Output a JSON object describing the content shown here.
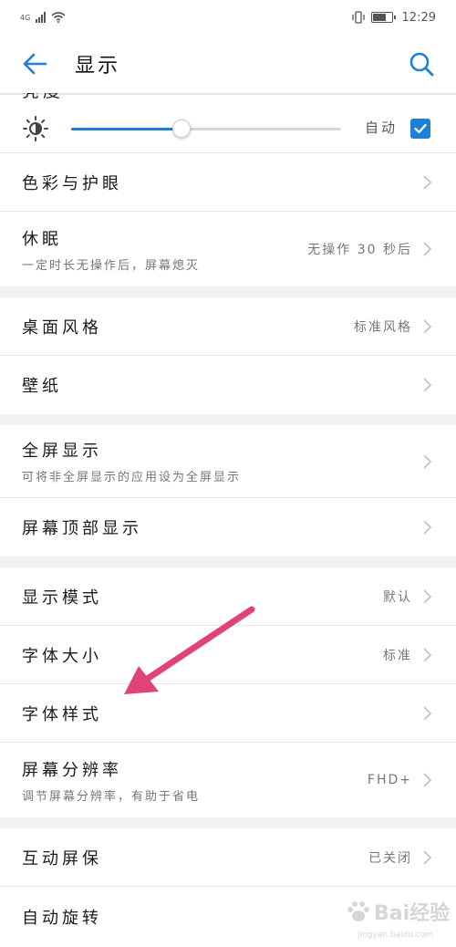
{
  "status_bar": {
    "network": "4G",
    "time": "12:29"
  },
  "app_bar": {
    "title": "显示"
  },
  "brightness": {
    "label": "亮度",
    "level": 0.41,
    "auto_label": "自动",
    "auto_checked": true
  },
  "sections": {
    "color": {
      "title": "色彩与护眼"
    },
    "sleep": {
      "title": "休眠",
      "subtitle": "一定时长无操作后，屏幕熄灭",
      "value": "无操作 30 秒后"
    },
    "home_style": {
      "title": "桌面风格",
      "value": "标准风格"
    },
    "wallpaper": {
      "title": "壁纸"
    },
    "full_screen": {
      "title": "全屏显示",
      "subtitle": "可将非全屏显示的应用设为全屏显示"
    },
    "top_display": {
      "title": "屏幕顶部显示"
    },
    "display_mode": {
      "title": "显示模式",
      "value": "默认"
    },
    "font_size": {
      "title": "字体大小",
      "value": "标准"
    },
    "font_style": {
      "title": "字体样式"
    },
    "resolution": {
      "title": "屏幕分辨率",
      "subtitle": "调节屏幕分辨率，有助于省电",
      "value": "FHD+"
    },
    "screensaver": {
      "title": "互动屏保",
      "value": "已关闭"
    },
    "auto_rotate": {
      "title": "自动旋转"
    }
  },
  "watermark": {
    "text": "Bai经验",
    "url": "jingyan.baidu.com"
  },
  "colors": {
    "accent": "#1e7fd6",
    "annotation_arrow": "#e0437a",
    "divider": "#e4e4e4",
    "section_gap": "#f1f1f1"
  }
}
